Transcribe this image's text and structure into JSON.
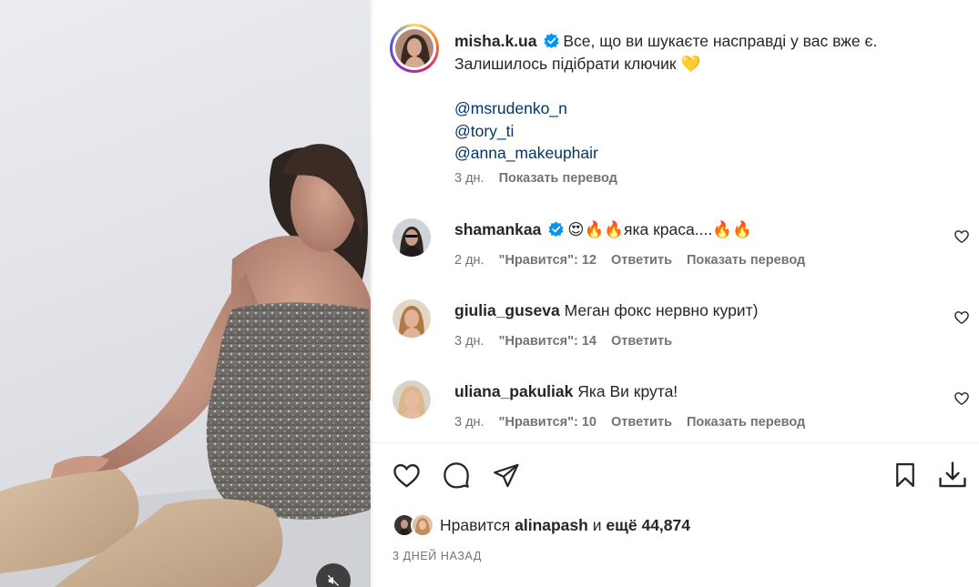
{
  "post": {
    "author": "misha.k.ua",
    "caption": "Все, що ви шукаєте насправді у вас вже є. Залишилось підібрати ключик",
    "caption_emoji": "💛",
    "mentions": [
      "@msrudenko_n",
      "@tory_ti",
      "@anna_makeuphair"
    ],
    "time": "3 дн.",
    "translate_label": "Показать перевод"
  },
  "comments": [
    {
      "user": "shamankaa",
      "verified": true,
      "text": "😍🔥🔥яка краса....🔥🔥",
      "time": "2 дн.",
      "likes": "\"Нравится\": 12",
      "reply": "Ответить",
      "translate": "Показать перевод"
    },
    {
      "user": "giulia_guseva",
      "verified": false,
      "text": "Меган фокс нервно курит)",
      "time": "3 дн.",
      "likes": "\"Нравится\": 14",
      "reply": "Ответить"
    },
    {
      "user": "uliana_pakuliak",
      "verified": false,
      "text": "Яка Ви крута!",
      "time": "3 дн.",
      "likes": "\"Нравится\": 10",
      "reply": "Ответить",
      "translate": "Показать перевод"
    }
  ],
  "likes": {
    "prefix": "Нравится",
    "user": "alinapash",
    "and": "и",
    "more": "ещё 44,874"
  },
  "date_label": "3 ДНЕЙ НАЗАД",
  "icons": {
    "like": "heart-icon",
    "comment": "comment-icon",
    "share": "share-icon",
    "save": "bookmark-icon",
    "download": "download-icon",
    "mute": "muted-speaker-icon",
    "verified": "verified-badge-icon"
  },
  "colors": {
    "link": "#00376b",
    "verified": "#0095f6",
    "muted_text": "#737373"
  }
}
